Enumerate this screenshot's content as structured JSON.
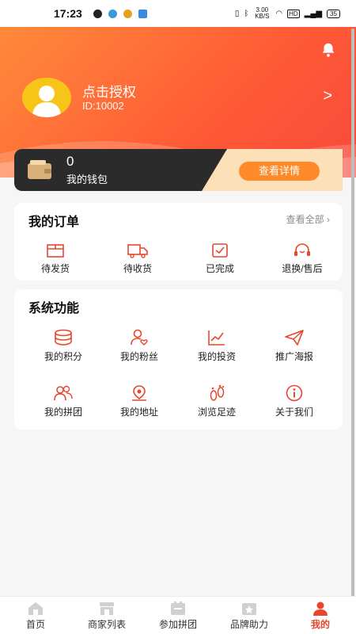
{
  "status_bar": {
    "time": "17:23",
    "network_speed": "3.00 KB/S",
    "battery": "35"
  },
  "profile": {
    "name": "点击授权",
    "id": "ID:10002",
    "arrow": ">"
  },
  "wallet": {
    "amount": "0",
    "label": "我的钱包",
    "button": "查看详情"
  },
  "orders": {
    "title": "我的订单",
    "view_all": "查看全部 ›",
    "items": [
      {
        "label": "待发货",
        "icon": "package-icon"
      },
      {
        "label": "待收货",
        "icon": "truck-icon"
      },
      {
        "label": "已完成",
        "icon": "check-box-icon"
      },
      {
        "label": "退换/售后",
        "icon": "headset-icon"
      }
    ]
  },
  "system": {
    "title": "系统功能",
    "items": [
      {
        "label": "我的积分",
        "icon": "coins-icon"
      },
      {
        "label": "我的粉丝",
        "icon": "user-heart-icon"
      },
      {
        "label": "我的投资",
        "icon": "chart-icon"
      },
      {
        "label": "推广海报",
        "icon": "paper-plane-icon"
      },
      {
        "label": "我的拼团",
        "icon": "users-icon"
      },
      {
        "label": "我的地址",
        "icon": "location-icon"
      },
      {
        "label": "浏览足迹",
        "icon": "footprint-icon"
      },
      {
        "label": "关于我们",
        "icon": "info-icon"
      }
    ]
  },
  "tabs": [
    {
      "label": "首页",
      "icon": "home-icon"
    },
    {
      "label": "商家列表",
      "icon": "store-icon"
    },
    {
      "label": "参加拼团",
      "icon": "group-icon"
    },
    {
      "label": "品牌助力",
      "icon": "brand-icon"
    },
    {
      "label": "我的",
      "icon": "me-icon",
      "active": true
    }
  ],
  "colors": {
    "accent": "#e8452c",
    "header_start": "#ff8a3a",
    "header_end": "#f84a3c",
    "wallet_dark": "#2b2b2b",
    "wallet_gold": "#fbe0b8",
    "button_orange": "#ff8a2a"
  }
}
